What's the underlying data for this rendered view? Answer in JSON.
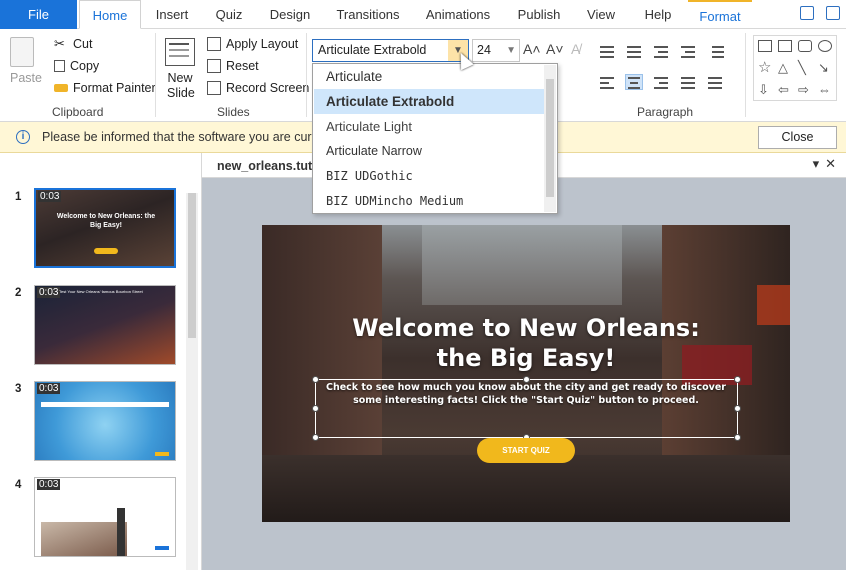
{
  "tabs": [
    "File",
    "Home",
    "Insert",
    "Quiz",
    "Design",
    "Transitions",
    "Animations",
    "Publish",
    "View",
    "Help",
    "Format"
  ],
  "ribbon": {
    "paste": "Paste",
    "cut": "Cut",
    "copy": "Copy",
    "format_painter": "Format Painter",
    "clipboard_label": "Clipboard",
    "new_slide": "New Slide",
    "apply_layout": "Apply Layout",
    "reset": "Reset",
    "record_screen": "Record Screen",
    "slides_label": "Slides",
    "font_name": "Articulate Extrabold",
    "font_size": "24",
    "paragraph_label": "Paragraph"
  },
  "font_dropdown": {
    "items": [
      "Articulate",
      "Articulate Extrabold",
      "Articulate Light",
      "Articulate Narrow",
      "BIZ UDGothic",
      "BIZ UDMincho Medium"
    ],
    "highlighted": "Articulate Extrabold"
  },
  "notice": {
    "message": "Please be informed that the software you are curren",
    "close": "Close"
  },
  "slides": [
    {
      "number": "1",
      "duration": "0:03",
      "title": "Welcome to New Orleans: the Big Easy!"
    },
    {
      "number": "2",
      "duration": "0:03",
      "title": "Test Your New Orleans' famous Bourbon Street"
    },
    {
      "number": "3",
      "duration": "0:03",
      "title": ""
    },
    {
      "number": "4",
      "duration": "0:03",
      "title": ""
    }
  ],
  "document": {
    "name": "new_orleans.tut"
  },
  "slide": {
    "title_line1": "Welcome to New Orleans:",
    "title_line2": "the Big Easy!",
    "subtitle": "Check to see how much you know about the city and get ready to discover some interesting facts! Click the \"Start Quiz\" button to proceed.",
    "button": "START QUIZ"
  },
  "colors": {
    "accent": "#1a73d9",
    "button": "#f1b81c",
    "notice_bg": "#fff7d6"
  }
}
